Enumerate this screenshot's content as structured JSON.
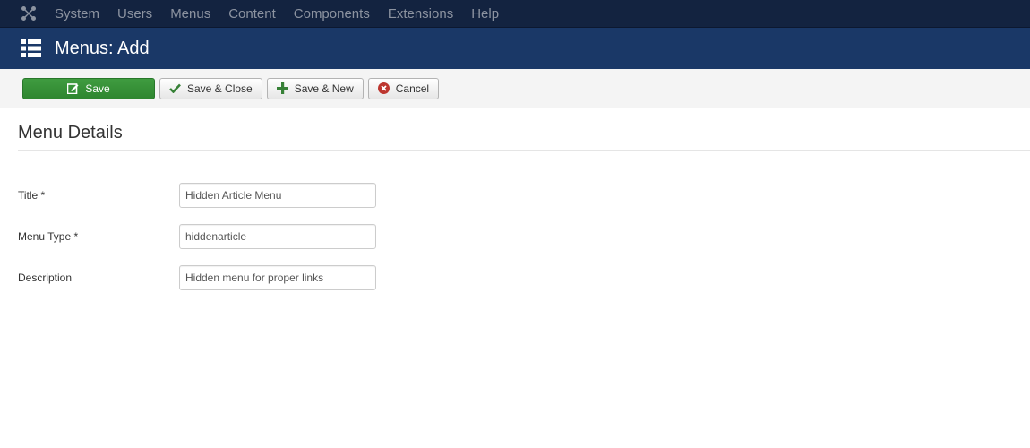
{
  "topnav": {
    "logo_icon": "joomla-logo-icon",
    "items": [
      {
        "label": "System"
      },
      {
        "label": "Users"
      },
      {
        "label": "Menus"
      },
      {
        "label": "Content"
      },
      {
        "label": "Components"
      },
      {
        "label": "Extensions"
      },
      {
        "label": "Help"
      }
    ]
  },
  "header": {
    "icon": "list-icon",
    "title": "Menus: Add"
  },
  "toolbar": {
    "save_label": "Save",
    "save_close_label": "Save & Close",
    "save_new_label": "Save & New",
    "cancel_label": "Cancel"
  },
  "main": {
    "section_title": "Menu Details",
    "fields": [
      {
        "label": "Title *",
        "value": "Hidden Article Menu"
      },
      {
        "label": "Menu Type *",
        "value": "hiddenarticle"
      },
      {
        "label": "Description",
        "value": "Hidden menu for proper links"
      }
    ]
  },
  "colors": {
    "topnav_bg": "#132340",
    "header_bg": "#1a3867",
    "save_green": "#2e862f",
    "cancel_red": "#bd362f"
  }
}
